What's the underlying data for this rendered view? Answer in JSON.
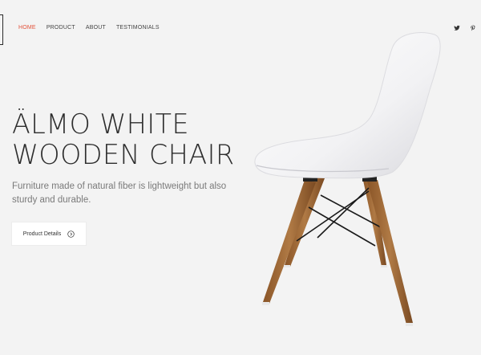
{
  "nav": {
    "items": [
      {
        "label": "HOME",
        "active": true
      },
      {
        "label": "PRODUCT",
        "active": false
      },
      {
        "label": "ABOUT",
        "active": false
      },
      {
        "label": "TESTIMONIALS",
        "active": false
      }
    ]
  },
  "social": {
    "icons": [
      "twitter-icon",
      "pinterest-icon"
    ]
  },
  "hero": {
    "title_line1": "ÄLMO WHITE",
    "title_line2": "WOODEN CHAIR",
    "description": "Furniture made of natural fiber is lightweight but also sturdy and durable.",
    "cta_label": "Product Details"
  },
  "colors": {
    "background": "#f3f3f3",
    "accent": "#e2513a",
    "text_dark": "#2d2d2d",
    "text_muted": "#7a7a7a"
  }
}
